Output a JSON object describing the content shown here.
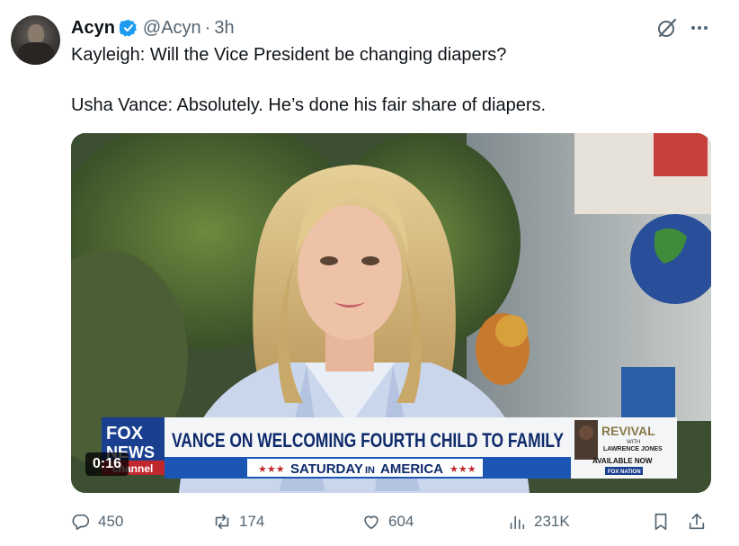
{
  "author": {
    "name": "Acyn",
    "handle": "@Acyn",
    "separator": "·",
    "time": "3h",
    "verified_color": "#1d9bf0"
  },
  "tweet": {
    "line1": "Kayleigh: Will the Vice President be changing diapers?",
    "line2": "Usha Vance: Absolutely. He’s done his fair share of diapers."
  },
  "media": {
    "duration": "0:16",
    "chyron_headline": "VANCE ON WELCOMING FOURTH CHILD TO FAMILY",
    "chyron_subline_prefix": "★★★",
    "chyron_subline_saturday": "SATURDAY",
    "chyron_subline_in": "IN",
    "chyron_subline_america": "AMERICA",
    "chyron_subline_suffix": "★★★",
    "logo_top": "FOX",
    "logo_bottom": "NEWS",
    "logo_channel": "channel",
    "promo_title": "REVIVAL",
    "promo_with": "WITH",
    "promo_host": "LAWRENCE JONES",
    "promo_available": "AVAILABLE NOW",
    "promo_brand": "FOX NATION"
  },
  "actions": {
    "replies": "450",
    "reposts": "174",
    "likes": "604",
    "views": "231K"
  },
  "colors": {
    "text_primary": "#0f1419",
    "text_secondary": "#536471",
    "fox_blue": "#1b3f8f",
    "chyron_text": "#0e2a6b"
  }
}
